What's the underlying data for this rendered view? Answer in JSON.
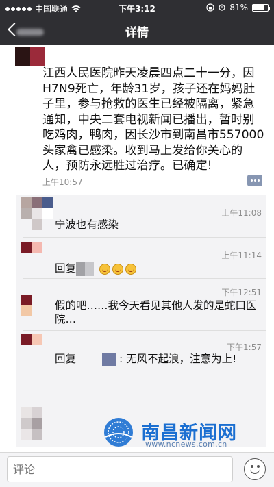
{
  "status_bar": {
    "carrier": "中国联通",
    "time": "下午3:12",
    "battery": "81%",
    "battery_level": 0.81
  },
  "nav": {
    "title": "详情"
  },
  "post": {
    "text": "江西人民医院昨天凌晨四点二十一分，因H7N9死亡，年龄31岁，孩子还在妈妈肚子里，参与抢救的医生已经被隔离，紧急通知，中央二套电视新闻已播出，暂时别吃鸡肉，鸭肉，因长沙市到南昌市557000头家禽已感染。收到马上发给你关心的人，预防永远胜过治疗。已确定!",
    "time": "上午10:57"
  },
  "comments": [
    {
      "time": "上午11:08",
      "text": "宁波也有感染"
    },
    {
      "time": "上午11:14",
      "reply_prefix": "回复"
    },
    {
      "time": "下午12:51",
      "text": "假的吧……我今天看见其他人发的是蛇口医院…"
    },
    {
      "time": "下午1:57",
      "reply_prefix": "回复",
      "text": ": 无风不起浪，注意为上!"
    }
  ],
  "watermark": {
    "title": "南昌新闻网",
    "url": "www.ncnews.com.cn"
  },
  "bottom": {
    "comment_placeholder": "评论"
  },
  "colors": {
    "topbar": "#2f2f33",
    "link": "#3b5a8d",
    "watermark": "#1b6fd1"
  }
}
